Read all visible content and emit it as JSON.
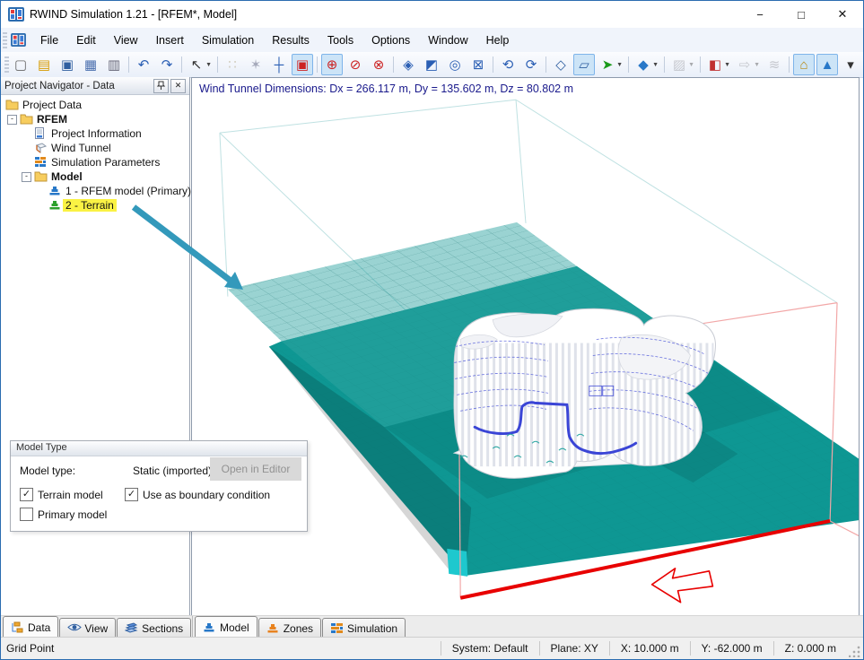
{
  "window": {
    "title": "RWIND Simulation 1.21 - [RFEM*, Model]",
    "controls": {
      "minimize": "−",
      "maximize": "□",
      "close": "✕"
    },
    "mdi_controls": {
      "minimize": "−",
      "restore": "❐",
      "close": "✕"
    }
  },
  "menubar": {
    "items": [
      "File",
      "Edit",
      "View",
      "Insert",
      "Simulation",
      "Results",
      "Tools",
      "Options",
      "Window",
      "Help"
    ]
  },
  "toolbar": {
    "icons": [
      {
        "name": "new-file-icon"
      },
      {
        "name": "open-file-icon"
      },
      {
        "name": "save-icon"
      },
      {
        "name": "print-preview-icon"
      },
      {
        "name": "print-icon"
      },
      {
        "name": "undo-icon",
        "sep": true
      },
      {
        "name": "redo-icon"
      },
      {
        "name": "selection-pointer-icon",
        "sep": true,
        "dropdown": true
      },
      {
        "name": "snap-points-icon",
        "sep": true,
        "state": "disabled"
      },
      {
        "name": "snap-objects-icon",
        "state": "disabled"
      },
      {
        "name": "snap-cross-icon"
      },
      {
        "name": "snap-grid-icon",
        "state": "toggled"
      },
      {
        "name": "rotation-mode-x-icon",
        "sep": true,
        "state": "toggled"
      },
      {
        "name": "rotation-mode-y-icon"
      },
      {
        "name": "rotation-mode-z-icon"
      },
      {
        "name": "zoom-extents-icon",
        "sep": true
      },
      {
        "name": "pan-view-icon"
      },
      {
        "name": "zoom-window-icon"
      },
      {
        "name": "fit-view-icon"
      },
      {
        "name": "rotate-ccw-icon",
        "sep": true
      },
      {
        "name": "rotate-cw-icon"
      },
      {
        "name": "isometric-view-icon",
        "sep": true
      },
      {
        "name": "wireframe-display-icon",
        "state": "toggled"
      },
      {
        "name": "view-direction-icon",
        "dropdown": true
      },
      {
        "name": "solid-display-icon",
        "sep": true,
        "dropdown": true
      },
      {
        "name": "section-plane-icon",
        "sep": true,
        "state": "disabled",
        "dropdown": true
      },
      {
        "name": "clipping-box-icon",
        "sep": true,
        "dropdown": true
      },
      {
        "name": "result-arrows-icon",
        "state": "disabled",
        "dropdown": true
      },
      {
        "name": "streamlines-icon",
        "state": "disabled"
      },
      {
        "name": "show-model-toggle-icon",
        "sep": true,
        "state": "toggled"
      },
      {
        "name": "show-terrain-toggle-icon",
        "state": "toggled"
      },
      {
        "name": "toolbar-overflow-icon"
      }
    ]
  },
  "navigator": {
    "title": "Project Navigator - Data",
    "tree": [
      {
        "label": "Project Data",
        "icon": "folder-icon",
        "level": 0
      },
      {
        "label": "RFEM",
        "icon": "folder-icon",
        "level": 1,
        "bold": true,
        "expander": "-"
      },
      {
        "label": "Project Information",
        "icon": "document-icon",
        "level": 2
      },
      {
        "label": "Wind Tunnel",
        "icon": "wind-tunnel-icon",
        "level": 2
      },
      {
        "label": "Simulation Parameters",
        "icon": "simulation-parameters-icon",
        "level": 2
      },
      {
        "label": "Model",
        "icon": "folder-icon",
        "level": 2,
        "bold": true,
        "expander": "-"
      },
      {
        "label": "1 - RFEM model (Primary)",
        "icon": "model-primary-icon",
        "level": 3
      },
      {
        "label": "2 - Terrain",
        "icon": "model-terrain-icon",
        "level": 3,
        "highlighted": true
      }
    ],
    "tabs": [
      {
        "label": "Data",
        "icon": "data-tab-icon",
        "active": true
      },
      {
        "label": "View",
        "icon": "eye-icon"
      },
      {
        "label": "Sections",
        "icon": "sections-icon"
      }
    ]
  },
  "viewport": {
    "dimensions_text": "Wind Tunnel Dimensions: Dx = 266.117 m, Dy = 135.602 m, Dz = 80.802 m",
    "tabs": [
      {
        "label": "Model",
        "icon": "model-tab-icon",
        "active": true
      },
      {
        "label": "Zones",
        "icon": "zones-tab-icon"
      },
      {
        "label": "Simulation",
        "icon": "simulation-tab-icon"
      }
    ]
  },
  "dialog": {
    "title": "Model Type",
    "type_label": "Model type:",
    "type_value": "Static (imported)",
    "open_button": "Open in Editor",
    "checkboxes": [
      {
        "label": "Terrain model",
        "checked": true
      },
      {
        "label": "Use as boundary condition",
        "checked": true
      },
      {
        "label": "Primary model",
        "checked": false
      }
    ]
  },
  "statusbar": {
    "left": "Grid Point",
    "system": "System: Default",
    "plane": "Plane: XY",
    "x": "X:  10.000 m",
    "y": "Y:  -62.000 m",
    "z": "Z:  0.000 m"
  },
  "colors": {
    "terrain_teal": "#0E9793",
    "cyan_edge": "#1EC8CE",
    "wire_teal": "#BFE1E2",
    "wire_pink": "#F2A7A7",
    "inlet_red": "#E80000",
    "model_blue": "#3A45D6",
    "highlight_yellow": "#FAF244",
    "annotation_teal": "#3399BB",
    "selection_blue": "#CCE4F7"
  }
}
